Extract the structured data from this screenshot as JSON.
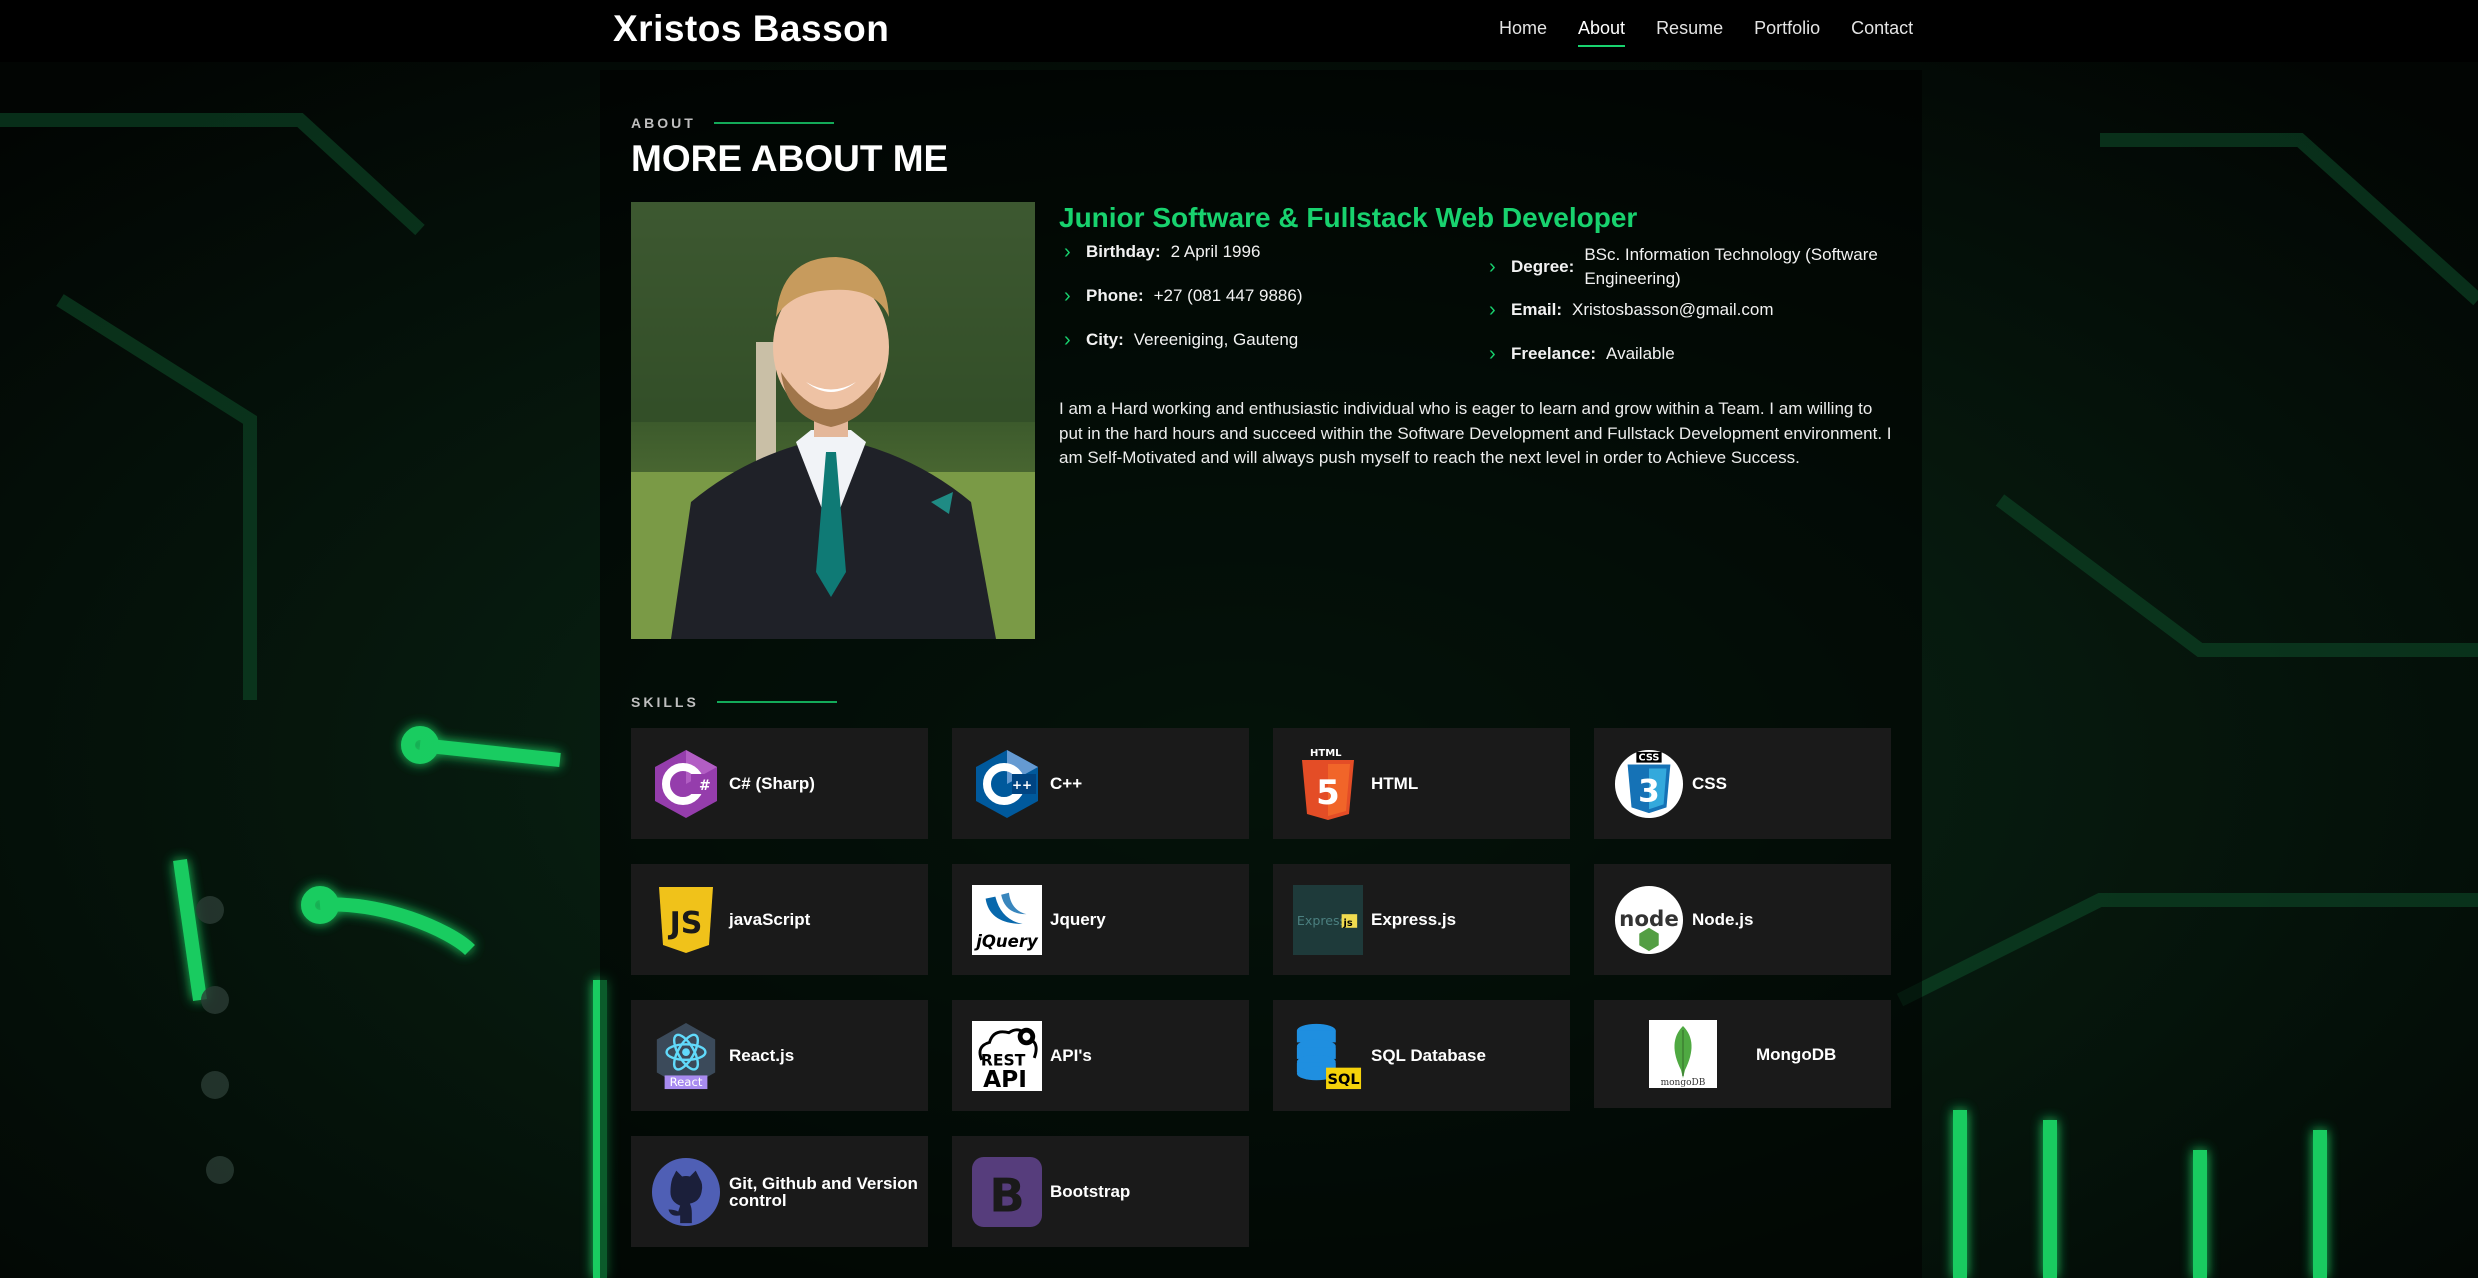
{
  "header": {
    "logo": "Xristos Basson",
    "nav": [
      "Home",
      "About",
      "Resume",
      "Portfolio",
      "Contact"
    ],
    "active_nav": "About"
  },
  "about": {
    "label": "ABOUT",
    "title": "MORE ABOUT ME",
    "role": "Junior Software & Fullstack Web Developer",
    "left_info": [
      {
        "key": "Birthday:",
        "value": "2 April 1996"
      },
      {
        "key": "Phone:",
        "value": "+27 (081 447 9886)"
      },
      {
        "key": "City:",
        "value": "Vereeniging, Gauteng"
      }
    ],
    "right_info": [
      {
        "key": "Degree:",
        "value": "BSc. Information Technology (Software Engineering)"
      },
      {
        "key": "Email:",
        "value": "Xristosbasson@gmail.com"
      },
      {
        "key": "Freelance:",
        "value": "Available"
      }
    ],
    "bio": "I am a Hard working and enthusiastic individual who is eager to learn and grow within a Team. I am willing to put in the hard hours and succeed within the Software Development and Fullstack Development environment. I am Self-Motivated and will always push myself to reach the next level in order to Achieve Success."
  },
  "skills": {
    "label": "SKILLS",
    "items": [
      {
        "name": "C# (Sharp)",
        "icon": "csharp-icon"
      },
      {
        "name": "C++",
        "icon": "cpp-icon"
      },
      {
        "name": "HTML",
        "icon": "html5-icon"
      },
      {
        "name": "CSS",
        "icon": "css3-icon"
      },
      {
        "name": "javaScript",
        "icon": "javascript-icon"
      },
      {
        "name": "Jquery",
        "icon": "jquery-icon"
      },
      {
        "name": "Express.js",
        "icon": "express-icon"
      },
      {
        "name": "Node.js",
        "icon": "nodejs-icon"
      },
      {
        "name": "React.js",
        "icon": "react-icon"
      },
      {
        "name": "API's",
        "icon": "rest-api-icon"
      },
      {
        "name": "SQL Database",
        "icon": "sql-database-icon"
      },
      {
        "name": "MongoDB",
        "icon": "mongodb-icon"
      },
      {
        "name": "Git, Github and Version control",
        "icon": "github-icon"
      },
      {
        "name": "Bootstrap",
        "icon": "bootstrap-icon"
      }
    ],
    "icon_text": {
      "html_badge": "HTML",
      "css_badge": "CSS",
      "js": "JS",
      "jquery": "jQuery",
      "express": "Express",
      "node": "node",
      "react": "React",
      "rest_top": "REST",
      "rest_bottom": "API",
      "sql": "SQL",
      "mongo": "mongoDB",
      "bootstrap": "B"
    }
  },
  "colors": {
    "accent": "#18d26e",
    "card": "#1a1a1a",
    "background": "#000000"
  }
}
